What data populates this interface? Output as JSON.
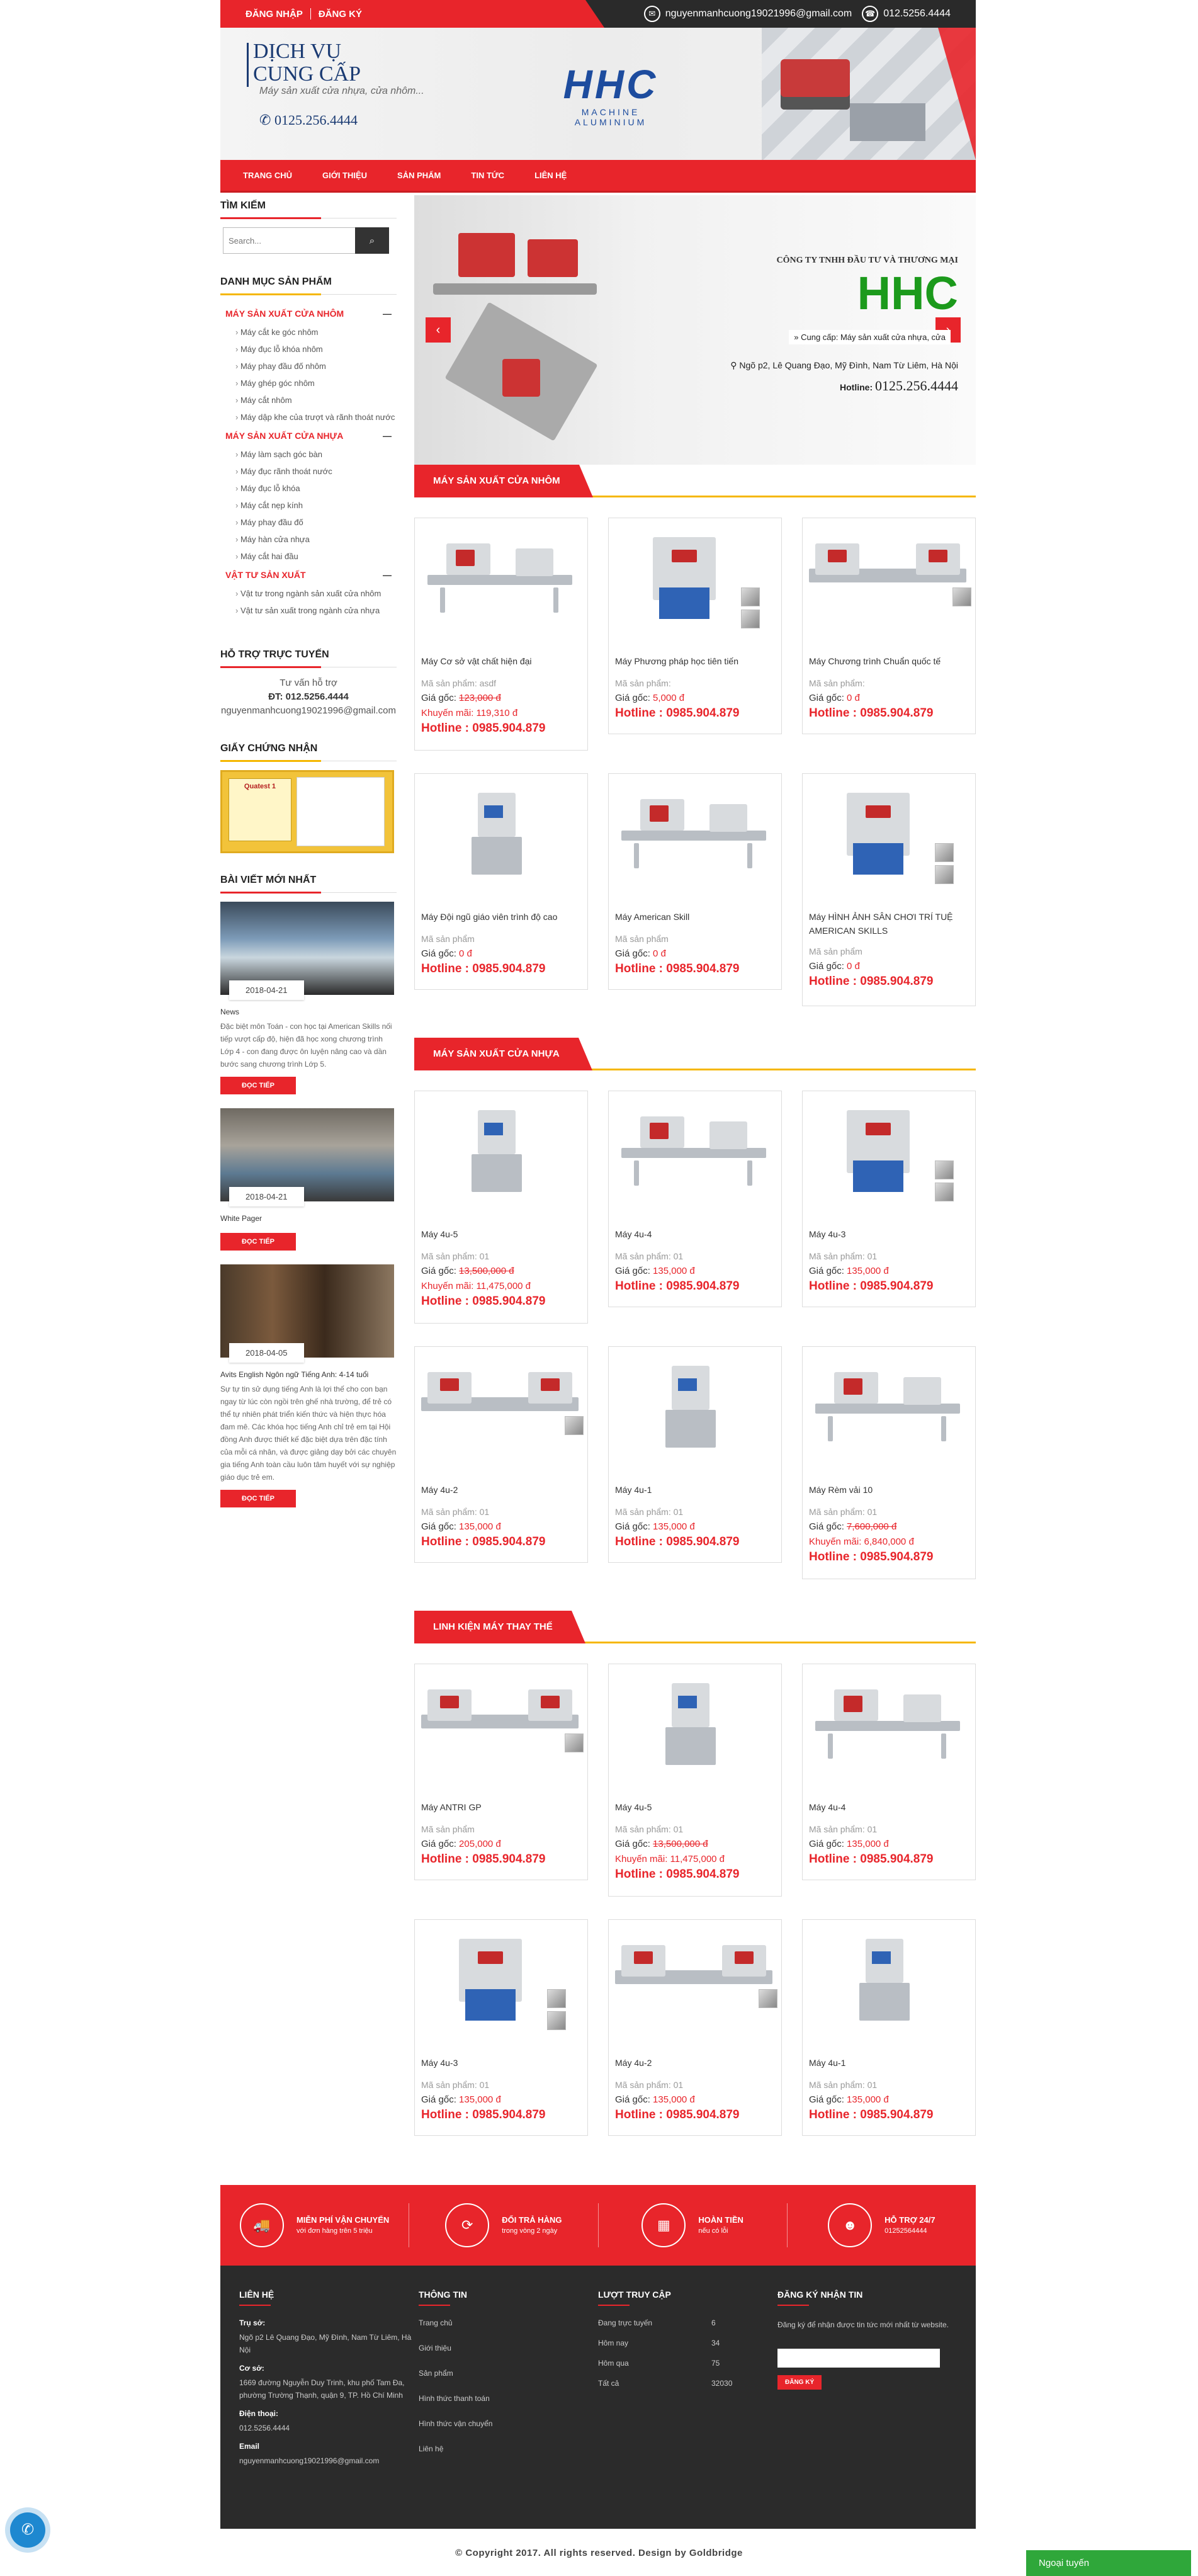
{
  "topbar": {
    "login": "ĐĂNG NHẬP",
    "register": "ĐĂNG KÝ",
    "email": "nguyenmanhcuong19021996@gmail.com",
    "phone": "012.5256.4444"
  },
  "banner": {
    "line1": "DỊCH VỤ",
    "line2": "CUNG CẤP",
    "sub": "Máy sản xuất cửa nhựa, cửa nhôm...",
    "phone": "0125.256.4444",
    "logo": "HHC",
    "logo_sub": "MACHINE ALUMINIUM"
  },
  "nav": [
    "TRANG CHỦ",
    "GIỚI THIỆU",
    "SẢN PHẨM",
    "TIN TỨC",
    "LIÊN HỆ"
  ],
  "sidebar": {
    "search_title": "TÌM KIẾM",
    "search_placeholder": "Search...",
    "cat_title": "DANH MỤC SẢN PHẨM",
    "cats": [
      {
        "name": "MÁY SẢN XUẤT CỬA NHÔM",
        "items": [
          "Máy cắt ke góc nhôm",
          "Máy đục lỗ khóa nhôm",
          "Máy phay đầu đố nhôm",
          "Máy ghép góc nhôm",
          "Máy cắt nhôm",
          "Máy dập khe của trượt và rãnh thoát nước"
        ]
      },
      {
        "name": "MÁY SẢN XUẤT CỬA NHỰA",
        "items": [
          "Máy làm sạch góc bàn",
          "Máy đục rãnh thoát nước",
          "Máy đục lỗ khóa",
          "Máy cắt nẹp kính",
          "Máy phay đầu đố",
          "Máy hàn cửa nhựa",
          "Máy cắt hai đầu"
        ]
      },
      {
        "name": "VẬT TƯ SẢN XUẤT",
        "items": [
          "Vật tư trong ngành sản xuất cửa nhôm",
          "Vật tư sản xuất trong ngành cửa nhựa"
        ]
      }
    ],
    "support_title": "HỖ TRỢ TRỰC TUYẾN",
    "support_line": "Tư vấn hỗ trợ",
    "support_phone": "ĐT: 012.5256.4444",
    "support_email": "nguyenmanhcuong19021996@gmail.com",
    "cert_title": "GIẤY CHỨNG NHẬN",
    "cert_text": "Quatest 1",
    "posts_title": "BÀI VIẾT MỚI NHẤT",
    "posts": [
      {
        "date": "2018-04-21",
        "title": "News",
        "desc": "Đặc biệt môn Toán - con học tại American Skills nối tiếp vượt cấp độ, hiện đã học xong chương trình Lớp 4 - con đang được ôn luyện nâng cao và dần bước sang chương trình Lớp 5.",
        "more": "ĐỌC TIẾP"
      },
      {
        "date": "2018-04-21",
        "title": "White Pager",
        "desc": "",
        "more": "ĐỌC TIẾP"
      },
      {
        "date": "2018-04-05",
        "title": "Avits English Ngôn ngữ Tiếng Anh: 4-14 tuổi",
        "desc": "Sự tự tin sử dụng tiếng Anh là lợi thế cho con bạn ngay từ lúc còn ngồi trên ghế nhà trường, để trẻ có thể tự nhiên phát triển kiến thức và hiện thực hóa đam mê. Các khóa học tiếng Anh chỉ trẻ em tại Hội đồng Anh được thiết kế đặc biệt dựa trên đặc tính của mỗi cá nhân, và được giảng dạy bởi các chuyên gia tiếng Anh toàn cầu luôn tâm huyết với sự nghiệp giáo dục trẻ em.",
        "more": "ĐỌC TIẾP"
      }
    ]
  },
  "slider": {
    "company": "CÔNG TY TNHH ĐẦU TƯ VÀ THƯƠNG MẠI",
    "brand": "HHC",
    "supply": "Cung cấp: Máy sản xuất cửa nhựa, cửa",
    "address": "Ngõ p2, Lê Quang Đạo, Mỹ Đình, Nam Từ Liêm, Hà Nội",
    "hotline_label": "Hotline:",
    "hotline": "0125.256.4444"
  },
  "sections": [
    {
      "title": "MÁY SẢN XUẤT CỬA NHÔM",
      "products": [
        {
          "name": "Máy Cơ sở vật chất hiện đại",
          "code": "Mã sản phẩm: asdf",
          "price_label": "Giá gốc:",
          "price": "123,000 đ",
          "strike": true,
          "sale": "Khuyến mãi: 119,310 đ",
          "hotline": "Hotline : 0985.904.879"
        },
        {
          "name": "Máy Phương pháp học tiên tiến",
          "code": "Mã sản phẩm:",
          "price_label": "Giá gốc:",
          "price": "5,000 đ",
          "strike": false,
          "sale": "",
          "hotline": "Hotline : 0985.904.879"
        },
        {
          "name": "Máy Chương trình Chuẩn quốc tế",
          "code": "Mã sản phẩm:",
          "price_label": "Giá gốc:",
          "price": "0 đ",
          "strike": false,
          "sale": "",
          "hotline": "Hotline : 0985.904.879"
        },
        {
          "name": "Máy Đội ngũ giáo viên trình độ cao",
          "code": "Mã sản phẩm",
          "price_label": "Giá gốc:",
          "price": "0 đ",
          "strike": false,
          "sale": "",
          "hotline": "Hotline : 0985.904.879"
        },
        {
          "name": "Máy American Skill",
          "code": "Mã sản phẩm",
          "price_label": "Giá gốc:",
          "price": "0 đ",
          "strike": false,
          "sale": "",
          "hotline": "Hotline : 0985.904.879"
        },
        {
          "name": "Máy HÌNH ẢNH SÂN CHƠI TRÍ TUỆ AMERICAN SKILLS",
          "code": "Mã sản phẩm",
          "price_label": "Giá gốc:",
          "price": "0 đ",
          "strike": false,
          "sale": "",
          "hotline": "Hotline : 0985.904.879"
        }
      ]
    },
    {
      "title": "MÁY SẢN XUẤT CỬA NHỰA",
      "products": [
        {
          "name": "Máy 4u-5",
          "code": "Mã sản phẩm: 01",
          "price_label": "Giá gốc:",
          "price": "13,500,000 đ",
          "strike": true,
          "sale": "Khuyến mãi: 11,475,000 đ",
          "hotline": "Hotline : 0985.904.879"
        },
        {
          "name": "Máy 4u-4",
          "code": "Mã sản phẩm: 01",
          "price_label": "Giá gốc:",
          "price": "135,000 đ",
          "strike": false,
          "sale": "",
          "hotline": "Hotline : 0985.904.879"
        },
        {
          "name": "Máy 4u-3",
          "code": "Mã sản phẩm: 01",
          "price_label": "Giá gốc:",
          "price": "135,000 đ",
          "strike": false,
          "sale": "",
          "hotline": "Hotline : 0985.904.879"
        },
        {
          "name": "Máy 4u-2",
          "code": "Mã sản phẩm: 01",
          "price_label": "Giá gốc:",
          "price": "135,000 đ",
          "strike": false,
          "sale": "",
          "hotline": "Hotline : 0985.904.879"
        },
        {
          "name": "Máy 4u-1",
          "code": "Mã sản phẩm: 01",
          "price_label": "Giá gốc:",
          "price": "135,000 đ",
          "strike": false,
          "sale": "",
          "hotline": "Hotline : 0985.904.879"
        },
        {
          "name": "Máy Rèm vải 10",
          "code": "Mã sản phẩm: 01",
          "price_label": "Giá gốc:",
          "price": "7,600,000 đ",
          "strike": true,
          "sale": "Khuyến mãi: 6,840,000 đ",
          "hotline": "Hotline : 0985.904.879"
        }
      ]
    },
    {
      "title": "LINH KIỆN MÁY THAY THẾ",
      "products": [
        {
          "name": "Máy ANTRI GP",
          "code": "Mã sản phẩm",
          "price_label": "Giá gốc:",
          "price": "205,000 đ",
          "strike": false,
          "sale": "",
          "hotline": "Hotline : 0985.904.879"
        },
        {
          "name": "Máy 4u-5",
          "code": "Mã sản phẩm: 01",
          "price_label": "Giá gốc:",
          "price": "13,500,000 đ",
          "strike": true,
          "sale": "Khuyến mãi: 11,475,000 đ",
          "hotline": "Hotline : 0985.904.879"
        },
        {
          "name": "Máy 4u-4",
          "code": "Mã sản phẩm: 01",
          "price_label": "Giá gốc:",
          "price": "135,000 đ",
          "strike": false,
          "sale": "",
          "hotline": "Hotline : 0985.904.879"
        },
        {
          "name": "Máy 4u-3",
          "code": "Mã sản phẩm: 01",
          "price_label": "Giá gốc:",
          "price": "135,000 đ",
          "strike": false,
          "sale": "",
          "hotline": "Hotline : 0985.904.879"
        },
        {
          "name": "Máy 4u-2",
          "code": "Mã sản phẩm: 01",
          "price_label": "Giá gốc:",
          "price": "135,000 đ",
          "strike": false,
          "sale": "",
          "hotline": "Hotline : 0985.904.879"
        },
        {
          "name": "Máy 4u-1",
          "code": "Mã sản phẩm: 01",
          "price_label": "Giá gốc:",
          "price": "135,000 đ",
          "strike": false,
          "sale": "",
          "hotline": "Hotline : 0985.904.879"
        }
      ]
    }
  ],
  "features": [
    {
      "icon": "truck-icon",
      "glyph": "🚚",
      "title": "MIỄN PHÍ VẬN CHUYỂN",
      "sub": "với đơn hàng trên 5 triệu"
    },
    {
      "icon": "refresh-icon",
      "glyph": "⟳",
      "title": "ĐỔI TRẢ HÀNG",
      "sub": "trong vòng 2 ngày"
    },
    {
      "icon": "calendar-icon",
      "glyph": "▦",
      "title": "HOÀN TIỀN",
      "sub": "nếu có lỗi"
    },
    {
      "icon": "users-icon",
      "glyph": "☻",
      "title": "HỖ TRỢ 24/7",
      "sub": "01252564444"
    }
  ],
  "footer": {
    "contact_title": "LIÊN HỆ",
    "hq_label": "Trụ sở:",
    "hq": "Ngõ p2 Lê Quang Đạo, Mỹ Đình, Nam Từ Liêm, Hà Nội",
    "branch_label": "Cơ sở:",
    "branch": "1669 đường Nguyễn Duy Trinh, khu phố Tam Đa, phường Trường Thạnh, quận 9, TP. Hồ Chí Minh",
    "phone_label": "Điện thoại:",
    "phone": "012.5256.4444",
    "email_label": "Email",
    "email": "nguyenmanhcuong19021996@gmail.com",
    "info_title": "THÔNG TIN",
    "info_links": [
      "Trang chủ",
      "Giới thiệu",
      "Sản phẩm",
      "Hình thức thanh toán",
      "Hình thức vận chuyển",
      "Liên hệ"
    ],
    "stats_title": "LƯỢT TRUY CẬP",
    "stats": [
      [
        "Đang trực tuyến",
        "6"
      ],
      [
        "Hôm nay",
        "34"
      ],
      [
        "Hôm qua",
        "75"
      ],
      [
        "Tất cả",
        "32030"
      ]
    ],
    "news_title": "ĐĂNG KÝ NHẬN TIN",
    "news_desc": "Đăng ký để nhận được tin tức mới nhất từ website.",
    "news_btn": "ĐĂNG KÝ"
  },
  "copyright": "© Copyright 2017. All rights reserved. Design by Goldbridge",
  "chat": "Ngoại tuyến"
}
